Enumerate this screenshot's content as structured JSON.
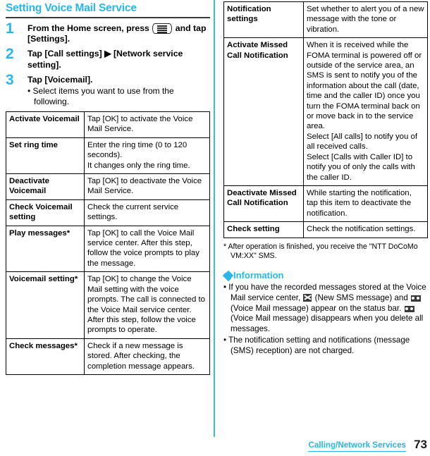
{
  "page": {
    "title": "Setting Voice Mail Service",
    "accent_color": "#29b6e8",
    "rule_color": "#3b3b3b"
  },
  "steps": [
    {
      "number": "1",
      "text_before_icon": "From the Home screen, press ",
      "icon": "menu-hard-key-icon",
      "text_after_icon": " and tap [Settings]."
    },
    {
      "number": "2",
      "text": "Tap [Call settings] ▶ [Network service setting]."
    },
    {
      "number": "3",
      "text": "Tap [Voicemail].",
      "bullet": "•",
      "sub_text": "Select items you want to use from the following."
    }
  ],
  "table_left": {
    "rows": [
      {
        "item": "Activate Voicemail",
        "description": "Tap [OK] to activate the Voice Mail Service."
      },
      {
        "item": "Set ring time",
        "description": "Enter the ring time (0 to 120 seconds).\nIt changes only the ring time."
      },
      {
        "item": "Deactivate Voicemail",
        "description": "Tap [OK] to deactivate the Voice Mail Service."
      },
      {
        "item": "Check Voicemail setting",
        "description": "Check the current service settings."
      },
      {
        "item": "Play messages*",
        "description": "Tap [OK] to call the Voice Mail service center. After this step, follow the voice prompts to play the message."
      },
      {
        "item": "Voicemail setting*",
        "description": "Tap [OK] to change the Voice Mail setting with the voice prompts. The call is connected to the Voice Mail service center. After this step, follow the voice prompts to operate."
      },
      {
        "item": "Check messages*",
        "description": "Check if a new message is stored. After checking, the completion message appears."
      }
    ]
  },
  "table_right": {
    "rows": [
      {
        "item": "Notification settings",
        "description": "Set whether to alert you of a new message with the tone or vibration."
      },
      {
        "item": "Activate Missed Call Notification",
        "description": "When it is received while the FOMA terminal is powered off or outside of the service area, an SMS is sent to notify you of the information about the call (date, time and the caller ID) once you turn the FOMA terminal back on or move back in to the service area.\nSelect [All calls] to notify you of all received calls.\nSelect [Calls with Caller ID] to notify you of only the calls with the caller ID."
      },
      {
        "item": "Deactivate Missed Call Notification",
        "description": "While starting the notification, tap this item to deactivate the notification."
      },
      {
        "item": "Check setting",
        "description": "Check the notification settings."
      }
    ]
  },
  "footnote": {
    "marker": "*",
    "text": "After operation is finished, you receive the \"NTT DoCoMo VM:XX\" SMS."
  },
  "information": {
    "heading": "Information",
    "heading_icon": "diamond-cluster-icon",
    "items": [
      {
        "bullet": "•",
        "part1": "If you have the recorded messages stored at the Voice Mail service center, ",
        "icon1": "new-sms-message-icon",
        "part2": " (New SMS message) and ",
        "icon2": "voice-mail-message-icon",
        "part3": " (Voice Mail message) appear on the status bar. ",
        "icon3": "voice-mail-message-icon",
        "part4": " (Voice Mail message) disappears when you delete all messages."
      },
      {
        "bullet": "•",
        "text": "The notification setting and notifications (message (SMS) reception) are not charged."
      }
    ]
  },
  "footer": {
    "section": "Calling/Network Services",
    "page_number": "73"
  }
}
